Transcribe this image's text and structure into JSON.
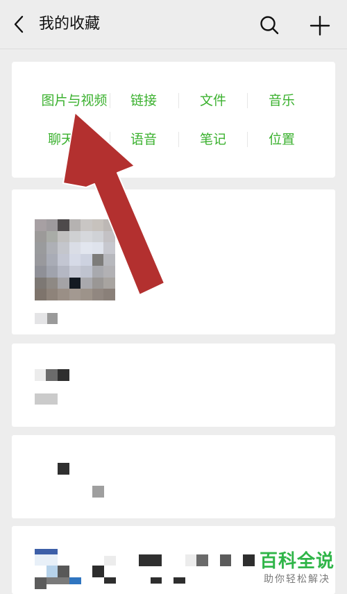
{
  "header": {
    "title": "我的收藏",
    "back_icon": "chevron-left-icon",
    "search_icon": "search-icon",
    "add_icon": "plus-icon"
  },
  "categories": [
    {
      "label": "图片与视频"
    },
    {
      "label": "链接"
    },
    {
      "label": "文件"
    },
    {
      "label": "音乐"
    },
    {
      "label": "聊天记录"
    },
    {
      "label": "语音"
    },
    {
      "label": "笔记"
    },
    {
      "label": "位置"
    }
  ],
  "accent_color": "#3bb12f",
  "annotation": {
    "arrow_color": "#b3302f"
  },
  "watermark": {
    "main": "百科全说",
    "sub": "助你轻松解决"
  }
}
